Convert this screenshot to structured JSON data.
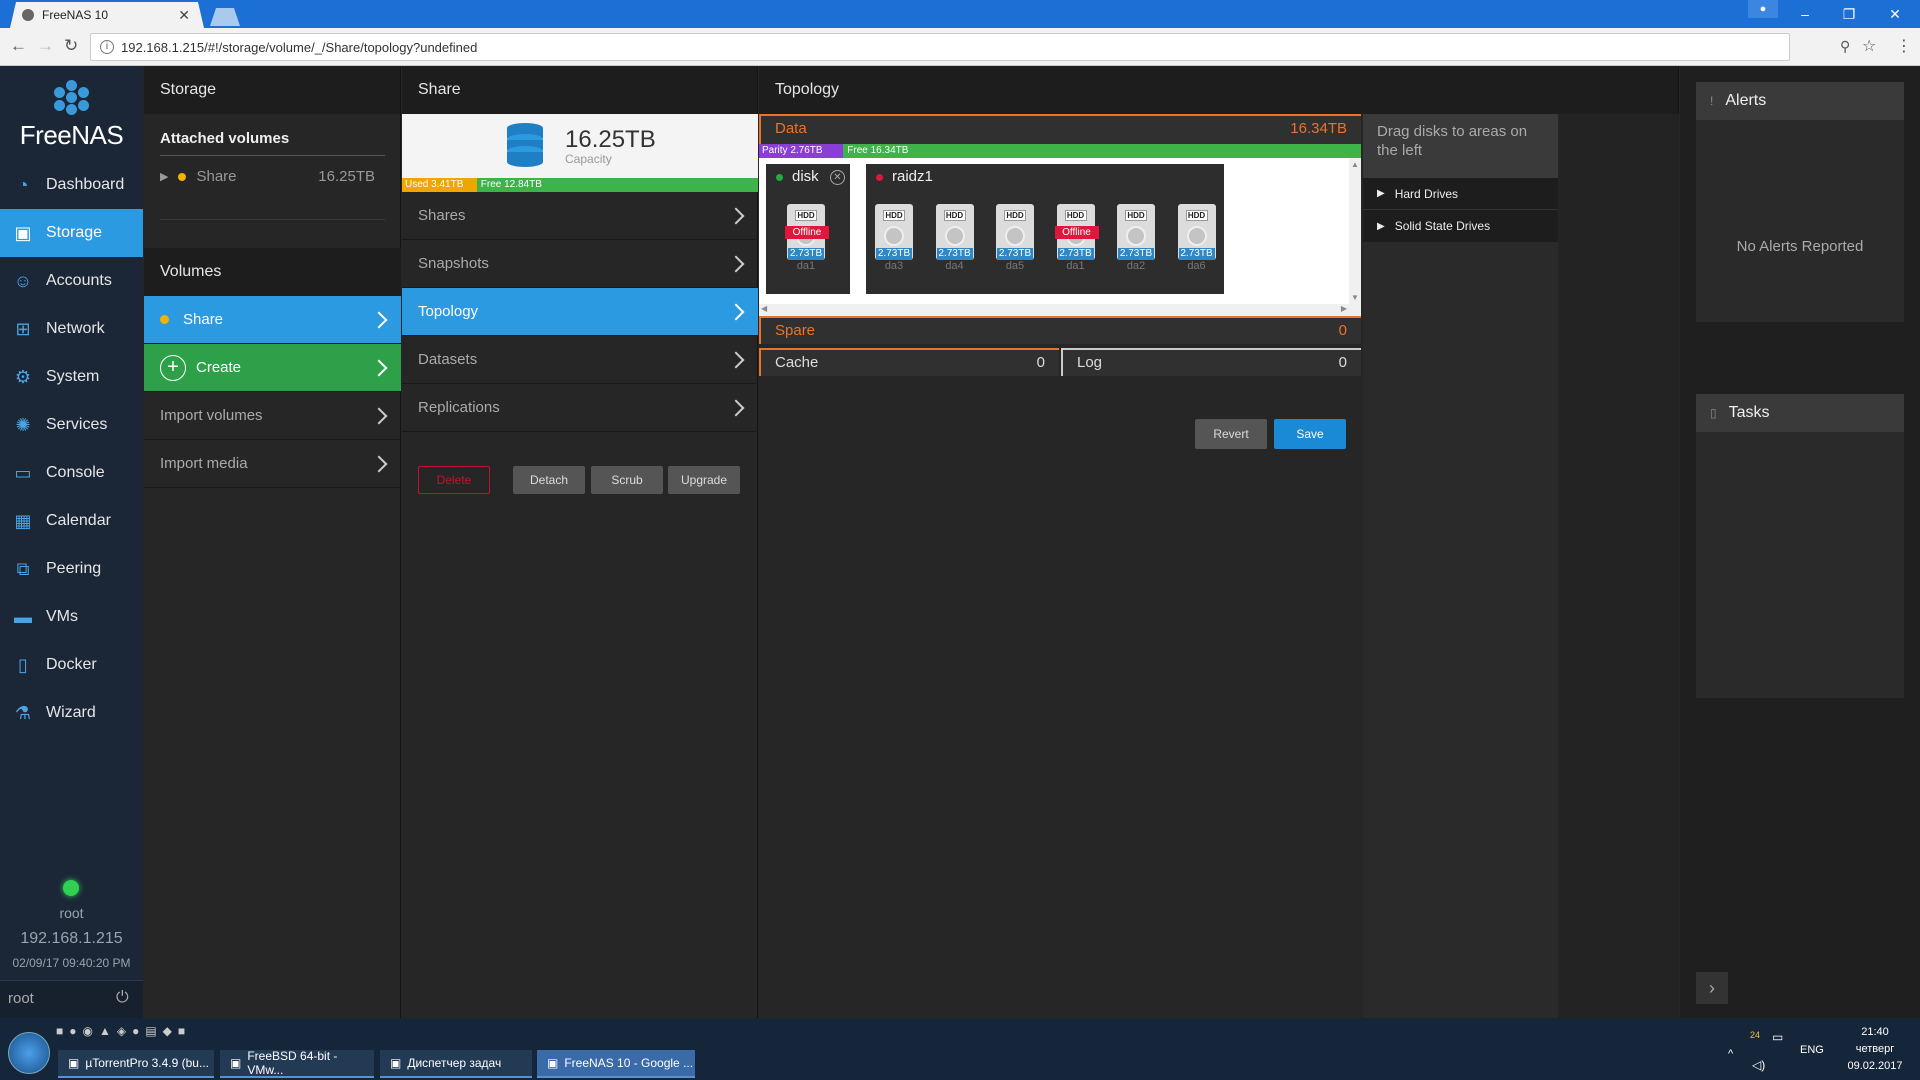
{
  "browser": {
    "tab_title": "FreeNAS 10",
    "close": "✕",
    "url": "192.168.1.215/#!/storage/volume/_/Share/topology?undefined"
  },
  "sidebar": {
    "logo": "FreeNAS",
    "items": [
      {
        "label": "Dashboard",
        "icon": "dashboard-icon",
        "glyph": "◔"
      },
      {
        "label": "Storage",
        "icon": "storage-icon",
        "glyph": "▣"
      },
      {
        "label": "Accounts",
        "icon": "accounts-icon",
        "glyph": "☺"
      },
      {
        "label": "Network",
        "icon": "network-icon",
        "glyph": "⊞"
      },
      {
        "label": "System",
        "icon": "system-icon",
        "glyph": "⚙"
      },
      {
        "label": "Services",
        "icon": "services-icon",
        "glyph": "✺"
      },
      {
        "label": "Console",
        "icon": "console-icon",
        "glyph": "▭"
      },
      {
        "label": "Calendar",
        "icon": "calendar-icon",
        "glyph": "▦"
      },
      {
        "label": "Peering",
        "icon": "peering-icon",
        "glyph": "⧉"
      },
      {
        "label": "VMs",
        "icon": "vms-icon",
        "glyph": "▬"
      },
      {
        "label": "Docker",
        "icon": "docker-icon",
        "glyph": "▯"
      },
      {
        "label": "Wizard",
        "icon": "wizard-icon",
        "glyph": "⚗"
      }
    ],
    "user": "root",
    "ip": "192.168.1.215",
    "datetime": "02/09/17 09:40:20 PM",
    "footer_user": "root"
  },
  "storage": {
    "header": "Storage",
    "attached_title": "Attached volumes",
    "attached": {
      "name": "Share",
      "size": "16.25TB"
    },
    "volumes_title": "Volumes",
    "share": "Share",
    "create": "Create",
    "import_volumes": "Import volumes",
    "import_media": "Import media"
  },
  "share": {
    "header": "Share",
    "capacity_value": "16.25TB",
    "capacity_label": "Capacity",
    "used": "Used 3.41TB",
    "free": "Free 12.84TB",
    "used_fraction": 0.21,
    "rows": [
      "Shares",
      "Snapshots",
      "Topology",
      "Datasets",
      "Replications"
    ],
    "buttons": {
      "delete": "Delete",
      "detach": "Detach",
      "scrub": "Scrub",
      "upgrade": "Upgrade"
    }
  },
  "topology": {
    "header": "Topology",
    "data_label": "Data",
    "data_size": "16.34TB",
    "parity": "Parity 2.76TB",
    "free": "Free 16.34TB",
    "parity_fraction": 0.14,
    "vdevs": [
      {
        "name": "disk",
        "dot": "#22aa44",
        "disks": [
          {
            "name": "da1",
            "size": "2.73TB",
            "offline": "Offline"
          }
        ]
      },
      {
        "name": "raidz1",
        "dot": "#e0163c",
        "disks": [
          {
            "name": "da3",
            "size": "2.73TB"
          },
          {
            "name": "da4",
            "size": "2.73TB"
          },
          {
            "name": "da5",
            "size": "2.73TB"
          },
          {
            "name": "da1",
            "size": "2.73TB",
            "offline": "Offline"
          },
          {
            "name": "da2",
            "size": "2.73TB"
          },
          {
            "name": "da6",
            "size": "2.73TB"
          }
        ]
      }
    ],
    "hdd_label": "HDD",
    "spare_label": "Spare",
    "spare_count": "0",
    "cache_label": "Cache",
    "cache_count": "0",
    "log_label": "Log",
    "log_count": "0",
    "revert": "Revert",
    "save": "Save"
  },
  "drag": {
    "hint": "Drag disks to areas on the left",
    "hard_drives": "Hard Drives",
    "ssd": "Solid State Drives"
  },
  "alerts": {
    "title": "Alerts",
    "empty": "No Alerts Reported"
  },
  "tasks": {
    "title": "Tasks"
  },
  "taskbar": {
    "items": [
      "µTorrentPro 3.4.9  (bu...",
      "FreeBSD 64-bit - VMw...",
      "Диспетчер задач",
      "FreeNAS 10 - Google ..."
    ],
    "lang": "ENG",
    "time": "21:40",
    "day": "четверг",
    "date": "09.02.2017",
    "tray_num": "24"
  }
}
